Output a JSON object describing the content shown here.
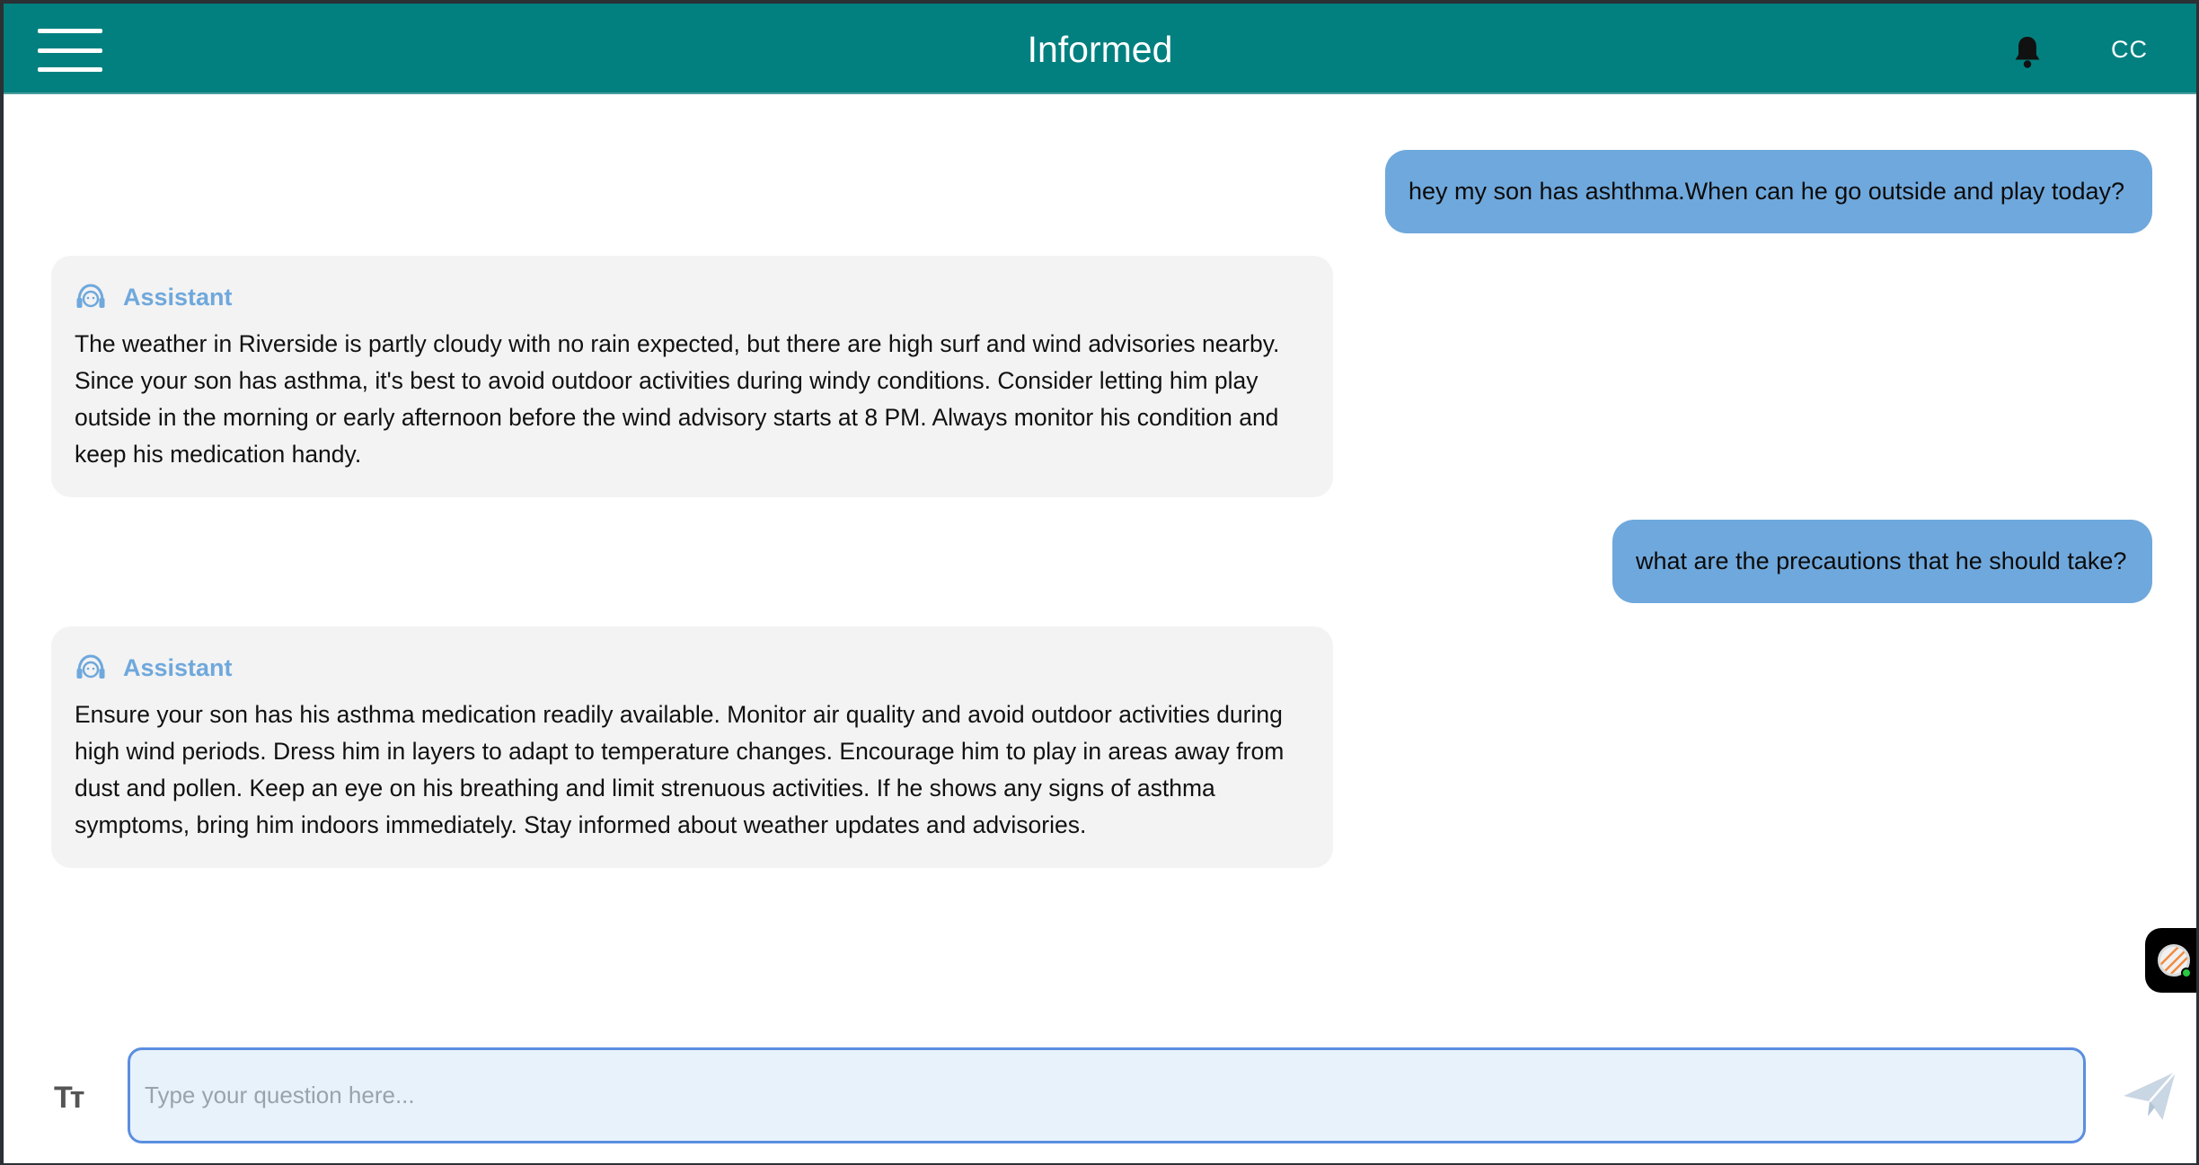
{
  "header": {
    "title": "Informed",
    "user_initials": "CC",
    "menu_icon": "hamburger-menu-icon",
    "bell_icon": "bell-icon",
    "background_color": "#028080"
  },
  "messages": [
    {
      "role": "user",
      "text": "hey my son has ashthma.When can he go outside and play today?"
    },
    {
      "role": "assistant",
      "name": "Assistant",
      "text": "The weather in Riverside is partly cloudy with no rain expected, but there are high surf and wind advisories nearby. Since your son has asthma, it's best to avoid outdoor activities during windy conditions. Consider letting him play outside in the morning or early afternoon before the wind advisory starts at 8 PM. Always monitor his condition and keep his medication handy."
    },
    {
      "role": "user",
      "text": "what are the precautions that he should take?"
    },
    {
      "role": "assistant",
      "name": "Assistant",
      "text": "Ensure your son has his asthma medication readily available. Monitor air quality and avoid outdoor activities during high wind periods. Dress him in layers to adapt to temperature changes. Encourage him to play in areas away from dust and pollen. Keep an eye on his breathing and limit strenuous activities. If he shows any signs of asthma symptoms, bring him indoors immediately. Stay informed about weather updates and advisories."
    }
  ],
  "composer": {
    "placeholder": "Type your question here...",
    "value": "",
    "font_size_icon": "text-size-icon",
    "font_size_glyph": "Tт",
    "send_icon": "send-icon"
  },
  "colors": {
    "user_bubble": "#6fa8dc",
    "assistant_bubble": "#f3f3f3",
    "assistant_name": "#6fa8dc",
    "input_border": "#5b8ee0"
  }
}
